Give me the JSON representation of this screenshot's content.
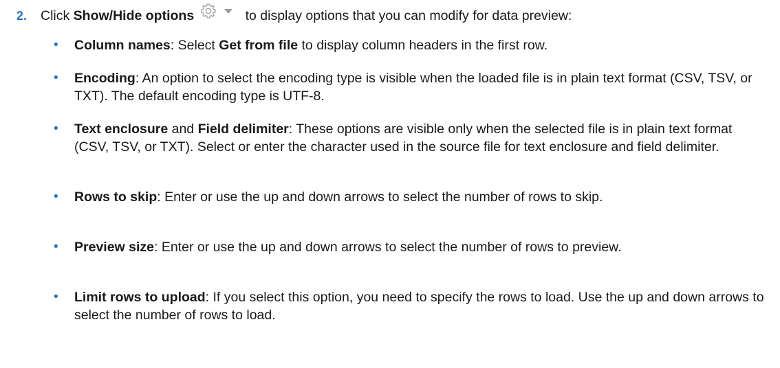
{
  "step": {
    "number": "2.",
    "text_before": "Click ",
    "bold_label": "Show/Hide options",
    "text_after": " to display options that you can modify for data preview:",
    "icon": "gear-dropdown-icon"
  },
  "bullets": [
    {
      "term": "Column names",
      "parts": [
        ": Select ",
        "Get from file",
        " to display column headers in the first row."
      ]
    },
    {
      "term": "Encoding",
      "text": ": An option to select the encoding type is visible when the loaded file is in plain text format (CSV, TSV, or TXT). The default encoding type is UTF-8."
    },
    {
      "term": "Text enclosure",
      "mid": " and ",
      "term2": "Field delimiter",
      "text": ": These options are visible only when the selected file is in plain text format (CSV, TSV, or TXT). Select or enter the character used in the source file for text enclosure and field delimiter."
    },
    {
      "term": "Rows to skip",
      "text": ": Enter or use the up and down arrows to select the number of rows to skip."
    },
    {
      "term": "Preview size",
      "text": ": Enter or use the up and down arrows to select the number of rows to preview."
    },
    {
      "term": "Limit rows to upload",
      "text": ": If you select this option, you need to specify the rows to load. Use the up and down arrows to select the number of rows to load."
    }
  ],
  "colors": {
    "accent": "#2a74b8",
    "text": "#1a1a1a",
    "icon": "#9a9a9a"
  }
}
